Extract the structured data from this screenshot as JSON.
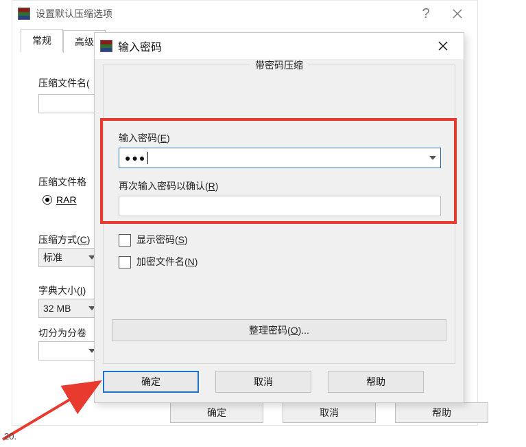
{
  "parent": {
    "title": "设置默认压缩选项",
    "tabs": {
      "general": "常规",
      "advanced": "高级"
    },
    "labels": {
      "archive_name": "压缩文件名(",
      "archive_format": "压缩文件格",
      "method": "压缩方式(C)",
      "dict_size": "字典大小(I)",
      "split": "切分为分卷"
    },
    "values": {
      "format_rar": "RAR",
      "method": "标准",
      "dict_size": "32 MB"
    },
    "buttons": {
      "ok": "确定",
      "cancel": "取消",
      "help": "帮助"
    }
  },
  "pw": {
    "title": "输入密码",
    "group_title": "带密码压缩",
    "enter_label": "输入密码(E)",
    "enter_value": "●●●",
    "reenter_label": "再次输入密码以确认(R)",
    "reenter_value": "",
    "show_pw": "显示密码(S)",
    "encrypt_names": "加密文件名(N)",
    "organize": "整理密码(O)...",
    "ok": "确定",
    "cancel": "取消",
    "help": "帮助"
  },
  "stray_text": "20."
}
